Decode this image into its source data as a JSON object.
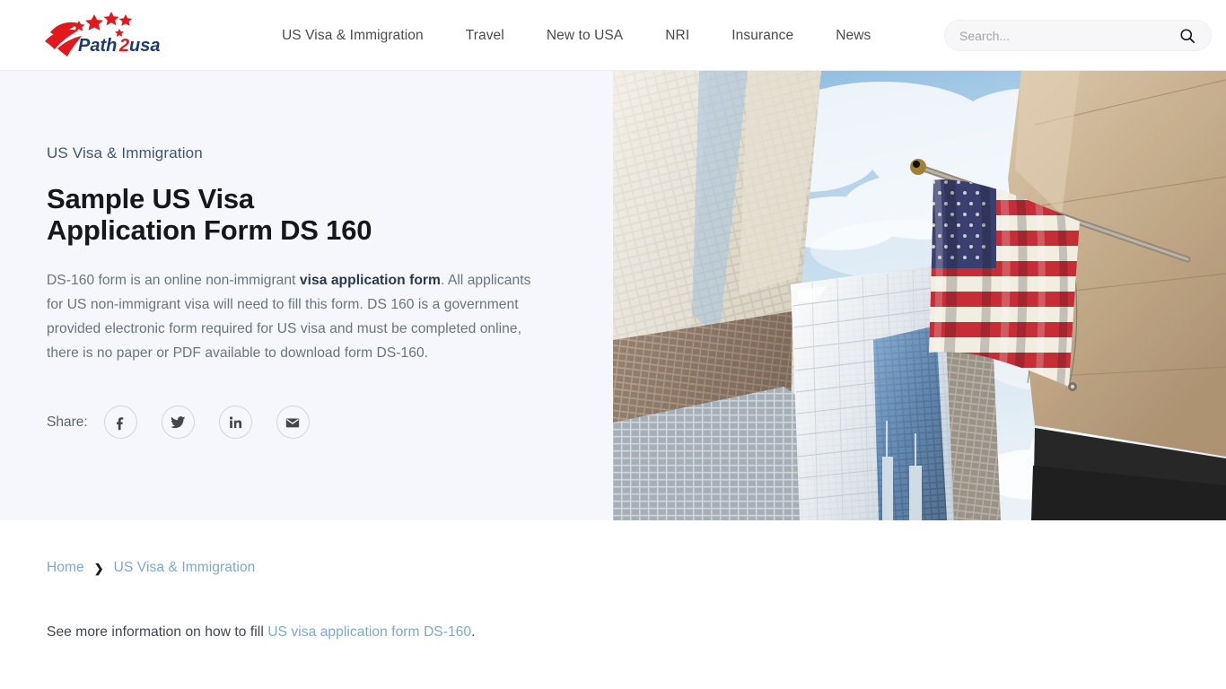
{
  "header": {
    "logo": {
      "name": "path2usa-logo",
      "text_part1": "Path",
      "text_part2": "2",
      "text_part3": "usa"
    },
    "nav": [
      {
        "label": "US Visa & Immigration"
      },
      {
        "label": "Travel"
      },
      {
        "label": "New to USA"
      },
      {
        "label": "NRI"
      },
      {
        "label": "Insurance"
      },
      {
        "label": "News"
      }
    ],
    "search": {
      "placeholder": "Search...",
      "value": "",
      "icon": "search-icon"
    }
  },
  "hero": {
    "eyebrow": "US Visa & Immigration",
    "title_line1": "Sample US Visa",
    "title_line2": "Application Form DS 160",
    "paragraph_before_link": "DS-160 form is an online non-immigrant ",
    "paragraph_link": "visa application form",
    "paragraph_after_link": ". All applicants for US non-immigrant visa will need to fill this form. DS 160 is a government provided electronic form required for US visa and must be completed online, there is no paper or PDF available to download form DS-160.",
    "share": {
      "label": "Share:",
      "buttons": [
        {
          "name": "facebook-icon",
          "title": "Facebook"
        },
        {
          "name": "twitter-icon",
          "title": "Twitter"
        },
        {
          "name": "linkedin-icon",
          "title": "LinkedIn"
        },
        {
          "name": "email-icon",
          "title": "Email"
        }
      ]
    },
    "image_alt": "American flag on a pole with city skyscrapers viewed from below"
  },
  "breadcrumb": {
    "items": [
      {
        "label": "Home"
      },
      {
        "label": "US Visa & Immigration"
      }
    ],
    "separator": "❯"
  },
  "body": {
    "text_before_link": "See more information on how to fill ",
    "link": "US visa application form DS-160",
    "text_after_link": "."
  },
  "colors": {
    "hero_background": "#f6f7fc",
    "heading": "#15171c",
    "eyebrow": "#41566e",
    "paragraph": "#6a7380",
    "link_blue": "#7ba7d7",
    "logo_red": "#e2181c",
    "logo_navy": "#1b3b73",
    "nav_text": "#4a4a4f",
    "search_bg": "#f7f7fa"
  }
}
